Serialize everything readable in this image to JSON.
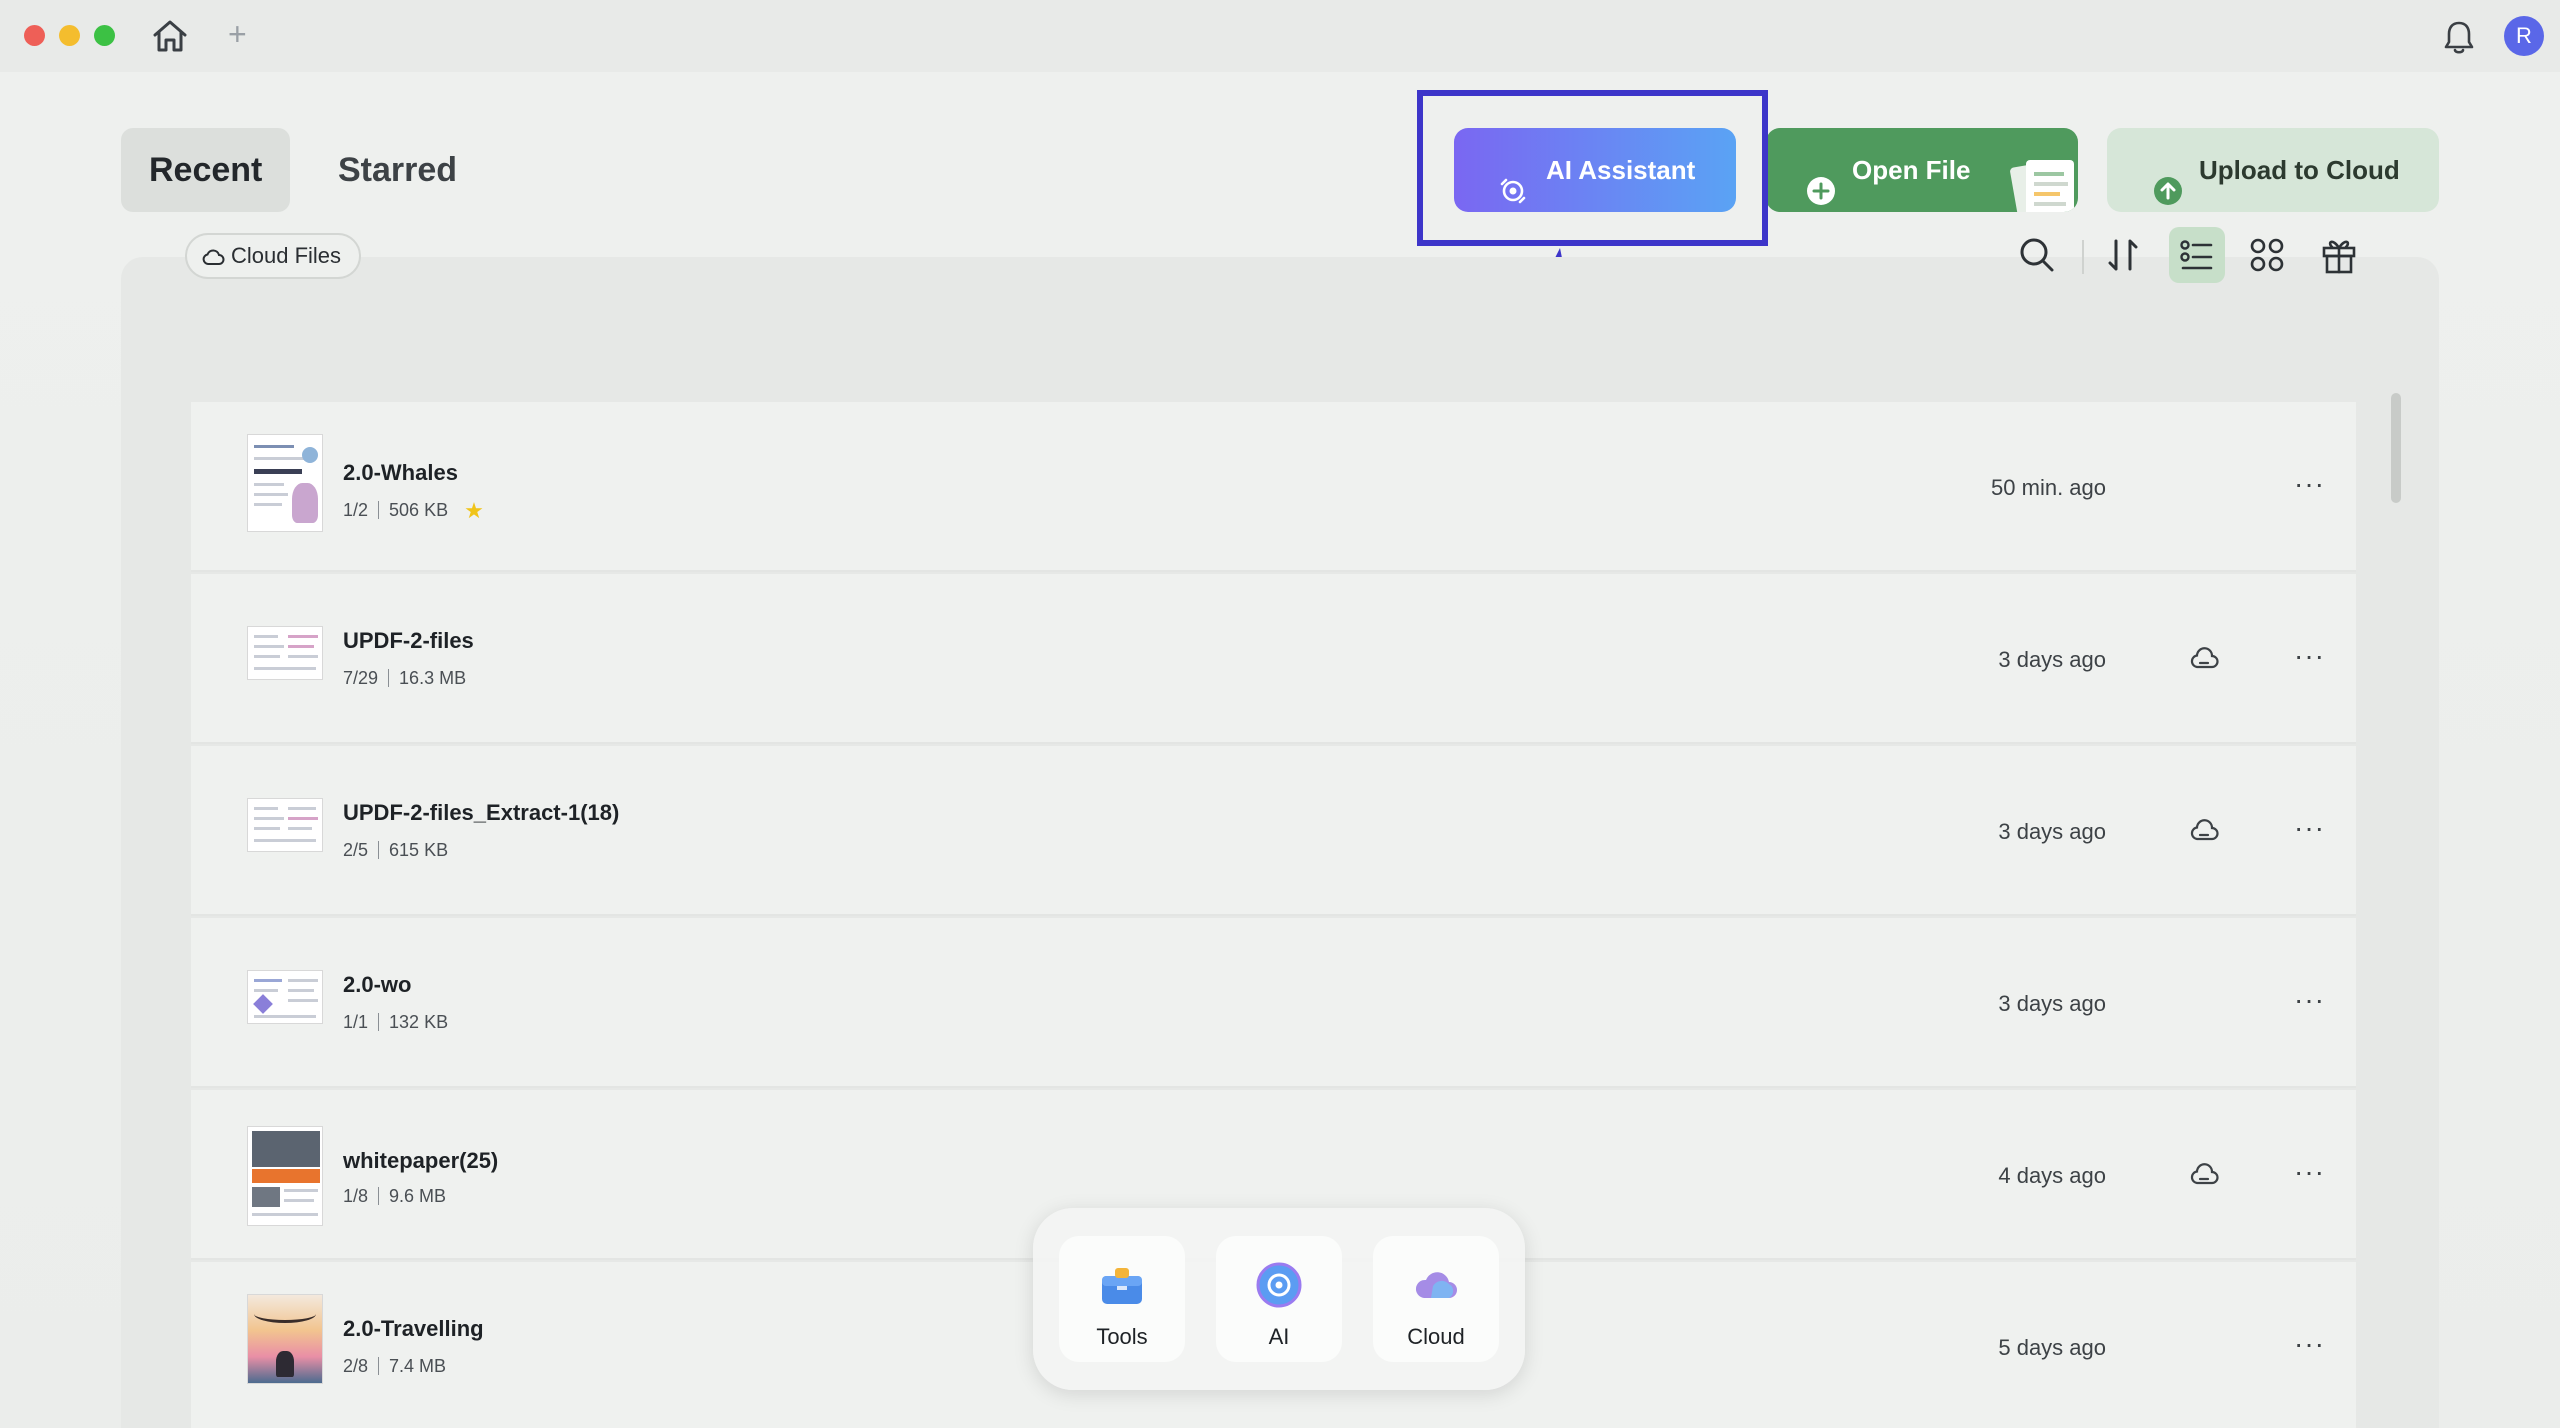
{
  "titlebar": {
    "avatar_initial": "R"
  },
  "tabs": [
    {
      "label": "Recent",
      "active": true
    },
    {
      "label": "Starred",
      "active": false
    }
  ],
  "actions": {
    "ai_assistant": "AI Assistant",
    "open_file": "Open File",
    "upload_cloud": "Upload to Cloud"
  },
  "filter": {
    "cloud_files": "Cloud Files"
  },
  "files": [
    {
      "name": "2.0-Whales",
      "pages": "1/2",
      "size": "506 KB",
      "starred": true,
      "time": "50 min. ago",
      "cloud": false
    },
    {
      "name": "UPDF-2-files",
      "pages": "7/29",
      "size": "16.3 MB",
      "starred": false,
      "time": "3 days ago",
      "cloud": true
    },
    {
      "name": "UPDF-2-files_Extract-1(18)",
      "pages": "2/5",
      "size": "615 KB",
      "starred": false,
      "time": "3 days ago",
      "cloud": true
    },
    {
      "name": "2.0-wo",
      "pages": "1/1",
      "size": "132 KB",
      "starred": false,
      "time": "3 days ago",
      "cloud": false
    },
    {
      "name": "whitepaper(25)",
      "pages": "1/8",
      "size": "9.6 MB",
      "starred": false,
      "time": "4 days ago",
      "cloud": true
    },
    {
      "name": "2.0-Travelling",
      "pages": "2/8",
      "size": "7.4 MB",
      "starred": false,
      "time": "5 days ago",
      "cloud": false
    }
  ],
  "dock": [
    {
      "label": "Tools"
    },
    {
      "label": "AI"
    },
    {
      "label": "Cloud"
    }
  ],
  "colors": {
    "ai_gradient_start": "#7a67f2",
    "ai_gradient_end": "#5aa3f4",
    "open_file": "#4f9a5d",
    "upload_cloud": "#d6e6d8",
    "highlight": "#3d35c9",
    "star": "#f0c419"
  }
}
